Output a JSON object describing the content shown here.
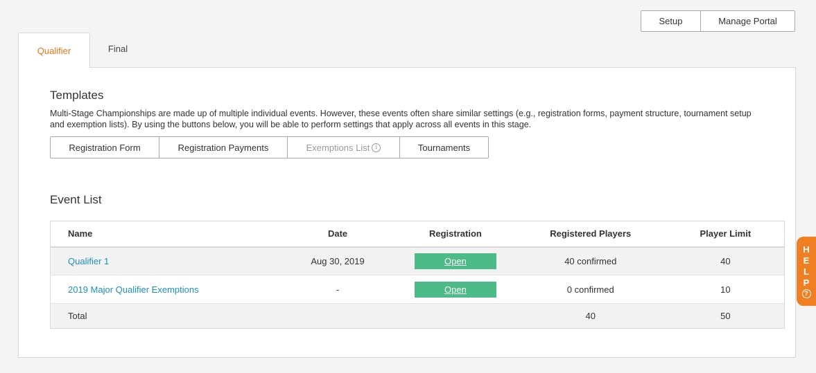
{
  "top_actions": {
    "setup": "Setup",
    "manage_portal": "Manage Portal"
  },
  "tabs": [
    {
      "label": "Qualifier",
      "active": true
    },
    {
      "label": "Final",
      "active": false
    }
  ],
  "templates": {
    "title": "Templates",
    "description": "Multi-Stage Championships are made up of multiple individual events. However, these events often share similar settings (e.g., registration forms, payment structure, tournament setup and exemption lists). By using the buttons below, you will be able to perform settings that apply across all events in this stage.",
    "buttons": {
      "registration_form": "Registration Form",
      "registration_payments": "Registration Payments",
      "exemptions_list": "Exemptions List",
      "tournaments": "Tournaments"
    },
    "info_glyph": "i"
  },
  "event_list": {
    "title": "Event List",
    "columns": {
      "name": "Name",
      "date": "Date",
      "registration": "Registration",
      "registered_players": "Registered Players",
      "player_limit": "Player Limit"
    },
    "rows": [
      {
        "name": "Qualifier 1",
        "date": "Aug 30, 2019",
        "registration": "Open",
        "registered_players": "40 confirmed",
        "player_limit": "40"
      },
      {
        "name": "2019 Major Qualifier Exemptions",
        "date": "-",
        "registration": "Open",
        "registered_players": "0 confirmed",
        "player_limit": "10"
      }
    ],
    "total": {
      "label": "Total",
      "registered_players": "40",
      "player_limit": "50"
    }
  },
  "help": {
    "letters": [
      "H",
      "E",
      "L",
      "P"
    ],
    "icon_glyph": "?"
  },
  "colors": {
    "accent": "#e8751a",
    "link": "#1c8fbf",
    "open": "#4cbb87",
    "help": "#f07f24"
  }
}
